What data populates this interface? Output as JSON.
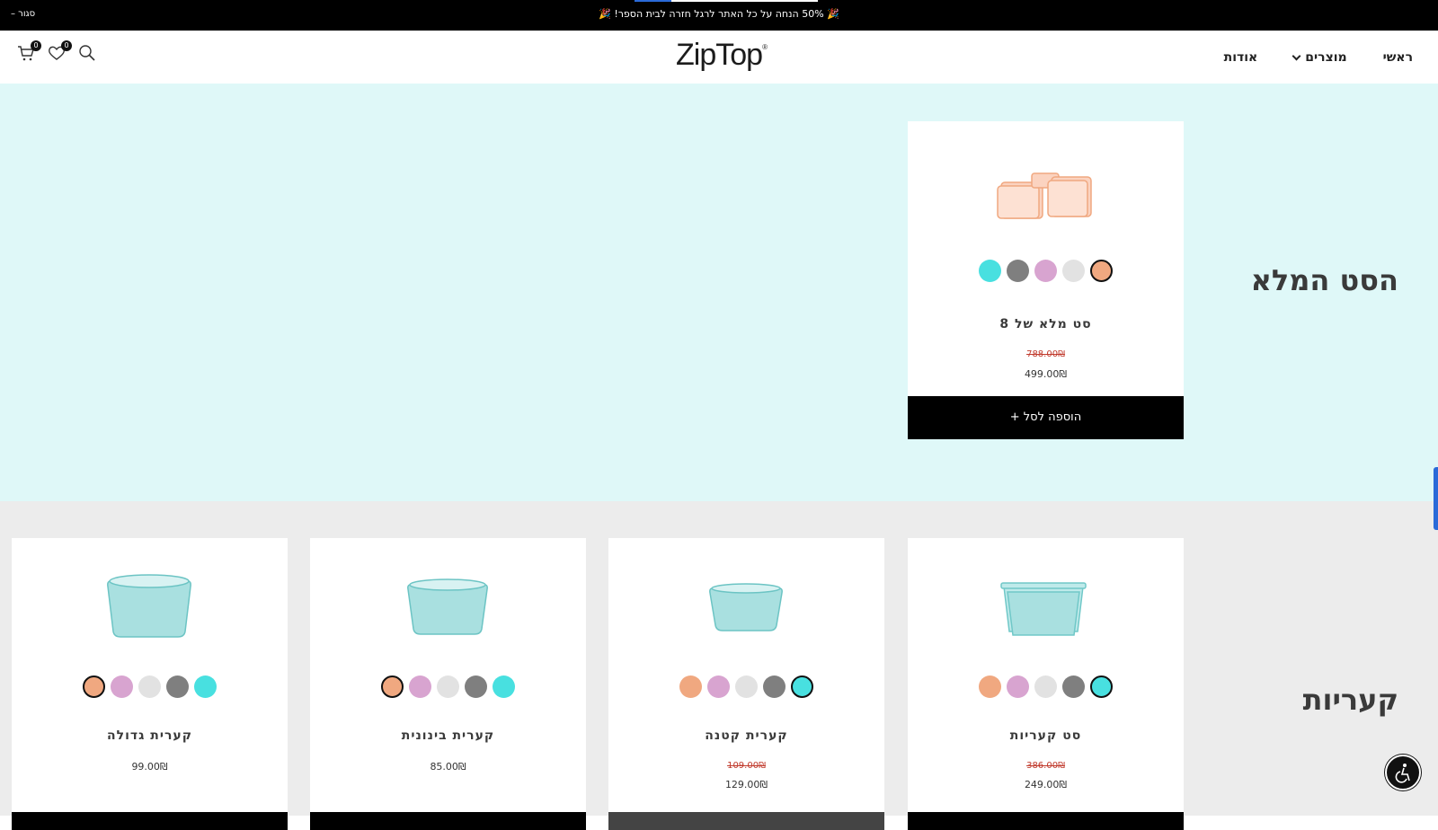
{
  "topbar": {
    "promo": "🎉 50% הנחה על כל האתר לרגל חזרה לבית הספר! 🎉",
    "close_label": "סגור –",
    "progress": 0.2
  },
  "header": {
    "logo": "ZipTop",
    "nav": {
      "home": "ראשי",
      "products": "מוצרים",
      "about": "אודות"
    },
    "cart_count": "0",
    "wishlist_count": "0",
    "icons": [
      "cart-icon",
      "heart-icon",
      "search-icon",
      "chevron-down-icon"
    ]
  },
  "colors": {
    "coral": "#f0a880",
    "pink": "#d8a4d0",
    "light": "#e2e2e2",
    "gray": "#7f7f7f",
    "teal": "#48e0e0",
    "bg_full_set": "#dff8f8",
    "bg_containers": "#ececec"
  },
  "full_set": {
    "title": "הסט המלא",
    "product": {
      "name": "סט מלא של 8",
      "old_price": "788.00₪",
      "price": "499.00₪",
      "add_label": "הוספה לסל +",
      "swatch_order": [
        "coral",
        "light",
        "pink",
        "gray",
        "teal"
      ],
      "selected": "coral"
    }
  },
  "containers": {
    "title": "קעריות",
    "products": [
      {
        "name": "סט קעריות",
        "old_price": "386.00₪",
        "price": "249.00₪",
        "swatch_order": [
          "teal",
          "gray",
          "light",
          "pink",
          "coral"
        ],
        "selected": "teal"
      },
      {
        "name": "קערית קטנה",
        "old_price": "109.00₪",
        "price": "129.00₪",
        "swatch_order": [
          "teal",
          "gray",
          "light",
          "pink",
          "coral"
        ],
        "selected": "teal"
      },
      {
        "name": "קערית בינונית",
        "old_price": "",
        "price": "85.00₪",
        "swatch_order": [
          "teal",
          "gray",
          "light",
          "pink",
          "coral"
        ],
        "selected": "coral"
      },
      {
        "name": "קערית גדולה",
        "old_price": "",
        "price": "99.00₪",
        "swatch_order": [
          "teal",
          "gray",
          "light",
          "pink",
          "coral"
        ],
        "selected": "coral"
      }
    ]
  }
}
